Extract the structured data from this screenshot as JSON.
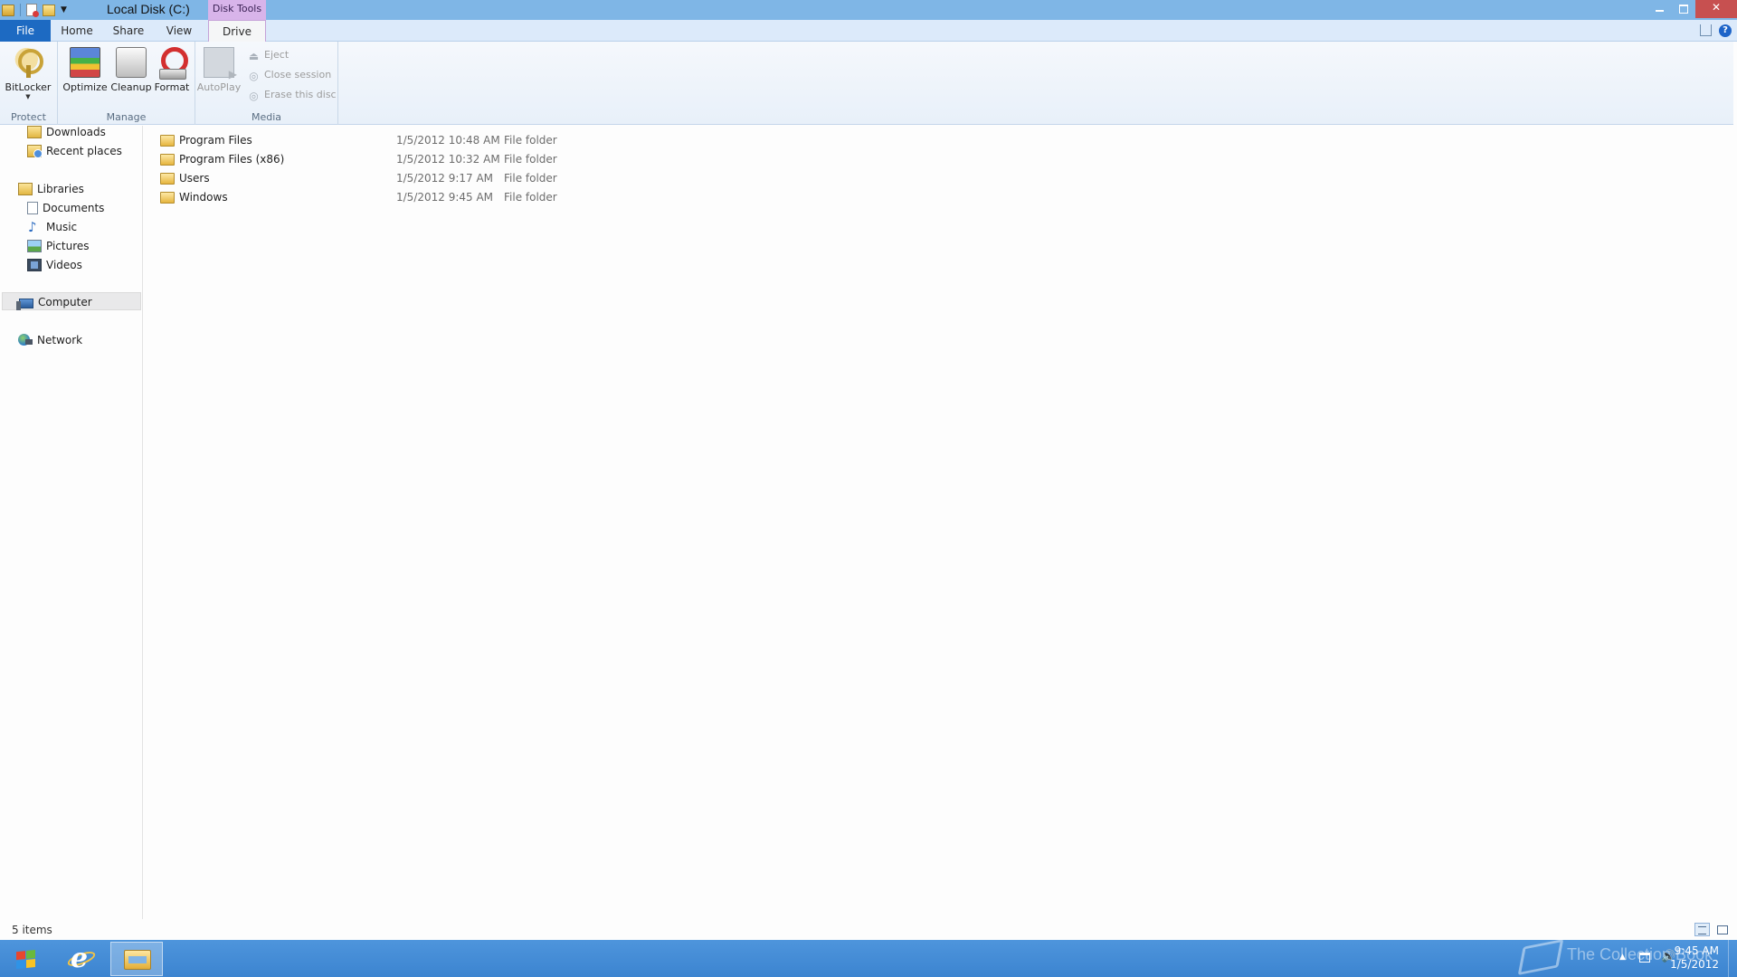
{
  "window": {
    "title": "Local Disk (C:)",
    "context_tab_header": "Disk Tools"
  },
  "ribbon_tabs": {
    "file": "File",
    "home": "Home",
    "share": "Share",
    "view": "View",
    "drive": "Drive"
  },
  "ribbon": {
    "groups": {
      "protect": "Protect",
      "manage": "Manage",
      "media": "Media"
    },
    "buttons": {
      "bitlocker": "BitLocker",
      "optimize": "Optimize",
      "cleanup": "Cleanup",
      "format": "Format",
      "autoplay": "AutoPlay",
      "eject": "Eject",
      "close_session": "Close session",
      "erase_disc": "Erase this disc"
    }
  },
  "nav": {
    "downloads": "Downloads",
    "recent_places": "Recent places",
    "libraries": "Libraries",
    "documents": "Documents",
    "music": "Music",
    "pictures": "Pictures",
    "videos": "Videos",
    "computer": "Computer",
    "network": "Network"
  },
  "files": [
    {
      "name": "Program Files",
      "date": "1/5/2012 10:48 AM",
      "type": "File folder"
    },
    {
      "name": "Program Files (x86)",
      "date": "1/5/2012 10:32 AM",
      "type": "File folder"
    },
    {
      "name": "Users",
      "date": "1/5/2012 9:17 AM",
      "type": "File folder"
    },
    {
      "name": "Windows",
      "date": "1/5/2012 9:45 AM",
      "type": "File folder"
    }
  ],
  "status": {
    "item_count": "5 items"
  },
  "taskbar": {
    "watermark": "The Collection Book",
    "clock_time": "9:45 AM",
    "clock_date": "1/5/2012"
  },
  "colors": {
    "titlebar": "#7fb6e6",
    "file_tab": "#1d6ac2",
    "context_tab": "#d8b4ea",
    "taskbar": "#4a90d9",
    "close_button": "#c75050"
  },
  "icons": {
    "window": "explorer-icon",
    "help": "help-icon",
    "folder": "folder-icon"
  }
}
